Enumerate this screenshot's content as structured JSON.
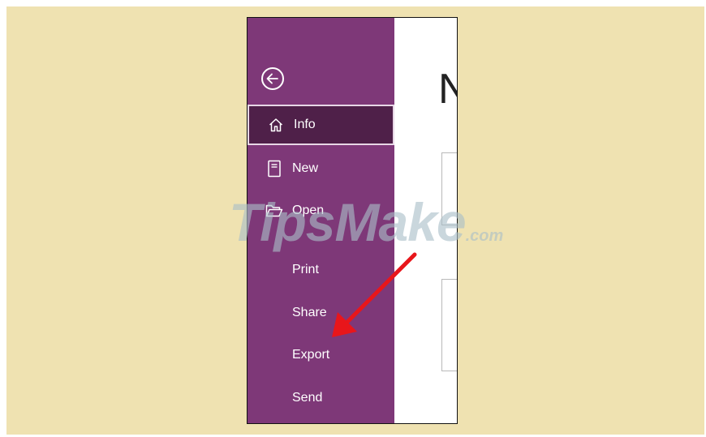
{
  "menu": {
    "items": [
      {
        "label": "Info",
        "icon": "home-icon",
        "active": true
      },
      {
        "label": "New",
        "icon": "notebook-icon"
      },
      {
        "label": "Open",
        "icon": "folder-open-icon"
      },
      {
        "label": "Print"
      },
      {
        "label": "Share"
      },
      {
        "label": "Export"
      },
      {
        "label": "Send"
      }
    ]
  },
  "content": {
    "heading_fragment": "N"
  },
  "watermark": {
    "brand": "TipsMake",
    "suffix": ".com"
  },
  "colors": {
    "sidebar": "#7e3878",
    "active_item": "#4f2049",
    "page_background": "#efe2b1",
    "arrow": "#e8161b"
  }
}
